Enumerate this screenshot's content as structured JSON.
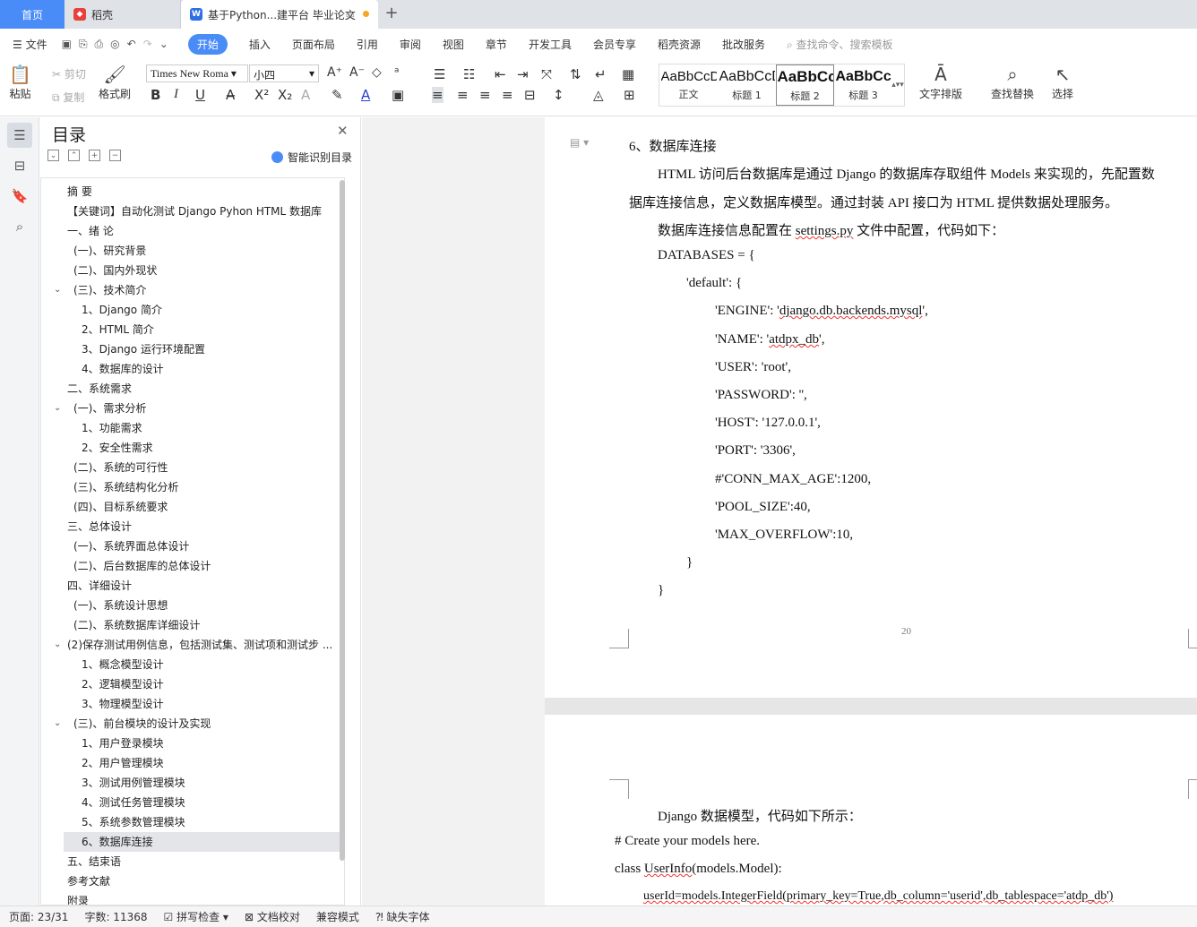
{
  "tabs": {
    "home": "首页",
    "daoke": "稻壳",
    "doc": "基于Python...建平台 毕业论文",
    "new": "+"
  },
  "menu": {
    "file": "文件",
    "items": [
      "开始",
      "插入",
      "页面布局",
      "引用",
      "审阅",
      "视图",
      "章节",
      "开发工具",
      "会员专享",
      "稻壳资源",
      "批改服务"
    ],
    "active": "开始",
    "search": "查找命令、搜索模板"
  },
  "ribbon": {
    "paste": "粘贴",
    "cut": "剪切",
    "copy": "复制",
    "format_painter": "格式刷",
    "font": "Times New Roma",
    "size": "小四",
    "styles": [
      {
        "preview": "AaBbCcDd",
        "name": "正文"
      },
      {
        "preview": "AaBbCcD",
        "name": "标题 1"
      },
      {
        "preview": "AaBbCc",
        "name": "标题 2"
      },
      {
        "preview": "AaBbCc",
        "name": "标题 3"
      }
    ],
    "text_layout": "文字排版",
    "find_replace": "查找替换",
    "select": "选择"
  },
  "toc": {
    "title": "目录",
    "smart": "智能识别目录",
    "items": [
      {
        "text": "摘  要",
        "level": 0
      },
      {
        "text": "【关键词】自动化测试  Django Pyhon HTML 数据库",
        "level": 0
      },
      {
        "text": "一、绪  论",
        "level": 0
      },
      {
        "text": "(一)、研究背景",
        "level": 1
      },
      {
        "text": "(二)、国内外现状",
        "level": 1
      },
      {
        "text": "(三)、技术简介",
        "level": 1,
        "caret": true
      },
      {
        "text": "1、Django 简介",
        "level": 2
      },
      {
        "text": "2、HTML 简介",
        "level": 2
      },
      {
        "text": "3、Django 运行环境配置",
        "level": 2
      },
      {
        "text": "4、数据库的设计",
        "level": 2
      },
      {
        "text": "二、系统需求",
        "level": 0
      },
      {
        "text": "(一)、需求分析",
        "level": 1,
        "caret": true
      },
      {
        "text": "1、功能需求",
        "level": 2
      },
      {
        "text": "2、安全性需求",
        "level": 2
      },
      {
        "text": "(二)、系统的可行性",
        "level": 1
      },
      {
        "text": "(三)、系统结构化分析",
        "level": 1
      },
      {
        "text": "(四)、目标系统要求",
        "level": 1
      },
      {
        "text": "三、总体设计",
        "level": 0
      },
      {
        "text": "(一)、系统界面总体设计",
        "level": 1
      },
      {
        "text": "(二)、后台数据库的总体设计",
        "level": 1
      },
      {
        "text": "四、详细设计",
        "level": 0
      },
      {
        "text": "(一)、系统设计思想",
        "level": 1
      },
      {
        "text": "(二)、系统数据库详细设计",
        "level": 1
      },
      {
        "text": "(2)保存测试用例信息，包括测试集、测试项和测试步 ...",
        "level": 1,
        "caret": true,
        "tight": true
      },
      {
        "text": "1、概念模型设计",
        "level": 2
      },
      {
        "text": "2、逻辑模型设计",
        "level": 2
      },
      {
        "text": "3、物理模型设计",
        "level": 2
      },
      {
        "text": "(三)、前台模块的设计及实现",
        "level": 1,
        "caret": true
      },
      {
        "text": "1、用户登录模块",
        "level": 2
      },
      {
        "text": "2、用户管理模块",
        "level": 2
      },
      {
        "text": "3、测试用例管理模块",
        "level": 2
      },
      {
        "text": "4、测试任务管理模块",
        "level": 2
      },
      {
        "text": "5、系统参数管理模块",
        "level": 2
      },
      {
        "text": "6、数据库连接",
        "level": 2,
        "selected": true
      },
      {
        "text": "五、结束语",
        "level": 0
      },
      {
        "text": "参考文献",
        "level": 0
      },
      {
        "text": "附录",
        "level": 0
      }
    ]
  },
  "doc": {
    "page1": {
      "heading": "6、数据库连接",
      "para1a": "HTML 访问后台数据库是通过 Django 的数据库存取组件 Models 来实现的，先配置数",
      "para1b": "据库连接信息，定义数据库模型。通过封装 API 接口为 HTML 提供数据处理服务。",
      "para2_pre": "数据库连接信息配置在 ",
      "para2_file": "settings.py",
      "para2_post": " 文件中配置，代码如下：",
      "code": [
        "DATABASES = {",
        "'default': {",
        "'ENGINE': 'django.db.backends.mysql',",
        "'NAME': 'atdpx_db',",
        "'USER': 'root',",
        "'PASSWORD': '',",
        "'HOST': '127.0.0.1',",
        "'PORT': '3306',",
        "#'CONN_MAX_AGE':1200,",
        "'POOL_SIZE':40,",
        "'MAX_OVERFLOW':10,",
        "}",
        "}"
      ],
      "page_number": "20"
    },
    "page2": {
      "intro": "Django 数据模型，代码如下所示：",
      "l1": "# Create your models here.",
      "l2_pre": "class ",
      "l2_name": "UserInfo",
      "l2_post": "(models.Model):",
      "l3": "userId=models.IntegerField(primary_key=True,db_column='userid',db_tablespace='atdp_db')"
    }
  },
  "status": {
    "page": "页面: 23/31",
    "words": "字数: 11368",
    "spell": "拼写检查",
    "proof": "文档校对",
    "compat": "兼容模式",
    "missing_font": "缺失字体"
  }
}
